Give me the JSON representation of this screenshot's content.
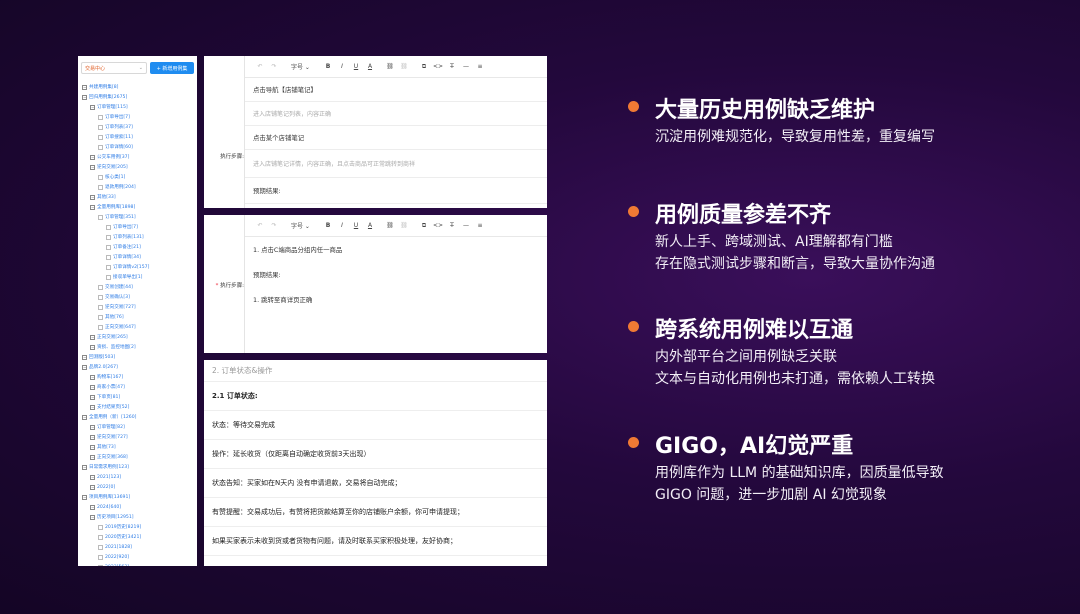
{
  "tree": {
    "select_value": "交易中心",
    "add_button": "+ 新增用例集",
    "nodes": [
      {
        "depth": 0,
        "label": "共建用例集[8]"
      },
      {
        "depth": 0,
        "label": "回归用例集[2675]"
      },
      {
        "depth": 1,
        "label": "订单管理[115]"
      },
      {
        "depth": 2,
        "label": "订单导出[7]"
      },
      {
        "depth": 2,
        "label": "订单列表[37]"
      },
      {
        "depth": 2,
        "label": "订单搜索[11]"
      },
      {
        "depth": 2,
        "label": "订单详情[60]"
      },
      {
        "depth": 1,
        "label": "公交车用例[37]"
      },
      {
        "depth": 1,
        "label": "逆向交易[205]"
      },
      {
        "depth": 2,
        "label": "核心类[1]"
      },
      {
        "depth": 2,
        "label": "退款用例[204]"
      },
      {
        "depth": 1,
        "label": "其他[33]"
      },
      {
        "depth": 1,
        "label": "全量用例库[1898]"
      },
      {
        "depth": 2,
        "label": "订单管理[351]"
      },
      {
        "depth": 3,
        "label": "订单导出[7]"
      },
      {
        "depth": 3,
        "label": "订单列表[131]"
      },
      {
        "depth": 3,
        "label": "订单备注[21]"
      },
      {
        "depth": 3,
        "label": "订单详情[34]"
      },
      {
        "depth": 3,
        "label": "订单详情v2[157]"
      },
      {
        "depth": 3,
        "label": "接収单导出[1]"
      },
      {
        "depth": 2,
        "label": "交易创建[44]"
      },
      {
        "depth": 2,
        "label": "交易确认[3]"
      },
      {
        "depth": 2,
        "label": "逆向交易[727]"
      },
      {
        "depth": 2,
        "label": "其他[76]"
      },
      {
        "depth": 2,
        "label": "正向交易[647]"
      },
      {
        "depth": 1,
        "label": "正向交易[265]"
      },
      {
        "depth": 1,
        "label": "资损、监控地图[2]"
      },
      {
        "depth": 0,
        "label": "回测版[503]"
      },
      {
        "depth": 0,
        "label": "品牌2.0[267]"
      },
      {
        "depth": 1,
        "label": "购物车[167]"
      },
      {
        "depth": 1,
        "label": "商家小票[47]"
      },
      {
        "depth": 1,
        "label": "下单页[81]"
      },
      {
        "depth": 1,
        "label": "支付结果页[52]"
      },
      {
        "depth": 0,
        "label": "全量用例（新）[1260]"
      },
      {
        "depth": 1,
        "label": "订单管理[82]"
      },
      {
        "depth": 1,
        "label": "逆向交易[727]"
      },
      {
        "depth": 1,
        "label": "其他[73]"
      },
      {
        "depth": 1,
        "label": "正向交易[368]"
      },
      {
        "depth": 0,
        "label": "日常需求用例[123]"
      },
      {
        "depth": 1,
        "label": "2021[123]"
      },
      {
        "depth": 1,
        "label": "2022[0]"
      },
      {
        "depth": 0,
        "label": "项目用例库[13691]"
      },
      {
        "depth": 1,
        "label": "2024[640]"
      },
      {
        "depth": 1,
        "label": "历史项目[12951]"
      },
      {
        "depth": 2,
        "label": "2019历史[8219]"
      },
      {
        "depth": 2,
        "label": "2020历史[3421]"
      },
      {
        "depth": 2,
        "label": "2021[1828]"
      },
      {
        "depth": 2,
        "label": "2022[920]"
      },
      {
        "depth": 2,
        "label": "2023[563]"
      }
    ]
  },
  "toolbar": {
    "undo": "↶",
    "redo": "↷",
    "font_size": "字号 ⌄",
    "bold": "B",
    "italic": "I",
    "underline": "U",
    "color": "A",
    "link": "⛓",
    "unlink": "⛓",
    "copy": "⧉",
    "code": "<>",
    "clear": "T̶",
    "hr": "—",
    "align": "≡"
  },
  "editor1": {
    "label": "执行步骤:",
    "rows": [
      {
        "text": "点击导航【店铺笔记】",
        "placeholder": false
      },
      {
        "text": "进入店铺笔记列表，内容正确",
        "placeholder": true
      },
      {
        "text": "点击某个店铺笔记",
        "placeholder": false
      },
      {
        "text": "进入店铺笔记详情，内容正确，且点击商品可正常跳转到商祥",
        "placeholder": true
      },
      {
        "text": "预期结果:",
        "placeholder": false
      }
    ]
  },
  "editor2": {
    "label_star": "*",
    "label": "执行步骤:",
    "rows": [
      {
        "text": "1. 点击C端商品分组内任一商品"
      },
      {
        "text": "预期结果:"
      },
      {
        "text": "1. 跳转至商详页正确"
      }
    ]
  },
  "doc": {
    "heading": "2. 订单状态&操作",
    "rows": [
      {
        "text": "2.1 订单状态:",
        "strong": true
      },
      {
        "text": "状态：等待交易完成",
        "strong": false
      },
      {
        "text": "操作：延长收货（仅距离自动确定收货前3天出现）",
        "strong": false
      },
      {
        "text": "状态告知：买家如在N天内 没有申请退款，交易将自动完成；",
        "strong": false
      },
      {
        "text": "有赞提醒：交易成功后，有赞将把货款结算至你的店铺账户余额，你可申请提现；",
        "strong": false
      },
      {
        "text": "如果买家表示未收到货或者货物有问题，请及时联系买家积极处理，友好协商；",
        "strong": false
      }
    ]
  },
  "points": [
    {
      "title": "大量历史用例缺乏维护",
      "lines": [
        "沉淀用例难规范化，导致复用性差，重复编写"
      ]
    },
    {
      "title": "用例质量参差不齐",
      "lines": [
        "新人上手、跨域测试、AI理解都有门槛",
        "存在隐式测试步骤和断言，导致大量协作沟通"
      ]
    },
    {
      "title": "跨系统用例难以互通",
      "lines": [
        "内外部平台之间用例缺乏关联",
        "文本与自动化用例也未打通，需依赖人工转换"
      ]
    },
    {
      "title": "GIGO，AI幻觉严重",
      "lines": [
        "用例库作为 LLM 的基础知识库，因质量低导致",
        "GIGO 问题，进一步加剧 AI 幻觉现象"
      ]
    }
  ],
  "colors": {
    "accent": "#f07a34",
    "link": "#2c7be5",
    "button": "#1f8cf0"
  }
}
